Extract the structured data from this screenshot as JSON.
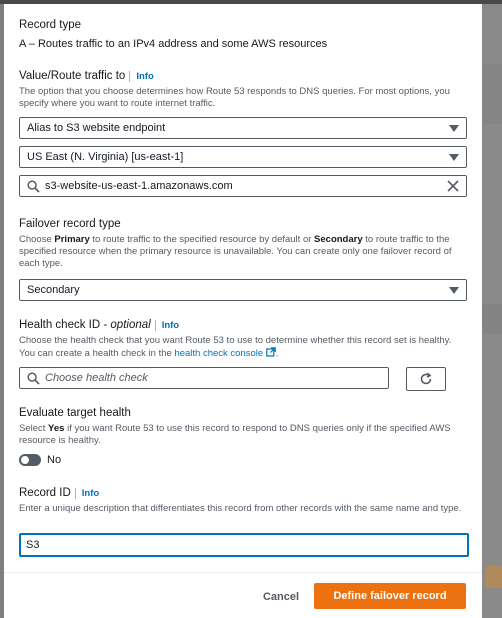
{
  "record_type": {
    "label": "Record type",
    "value": "A – Routes traffic to an IPv4 address and some AWS resources"
  },
  "value_route": {
    "label": "Value/Route traffic to",
    "info": "Info",
    "description": "The option that you choose determines how Route 53 responds to DNS queries. For most options, you specify where you want to route internet traffic.",
    "endpoint_type": "Alias to S3 website endpoint",
    "region": "US East (N. Virginia) [us-east-1]",
    "endpoint_value": "s3-website-us-east-1.amazonaws.com"
  },
  "failover": {
    "label": "Failover record type",
    "desc_1": "Choose ",
    "desc_primary": "Primary",
    "desc_2": " to route traffic to the specified resource by default or ",
    "desc_secondary": "Secondary",
    "desc_3": " to route traffic to the specified resource when the primary resource is unavailable. You can create only one failover record of each type.",
    "selected": "Secondary"
  },
  "health_check": {
    "label": "Health check ID - ",
    "optional": "optional",
    "info": "Info",
    "desc_1": "Choose the health check that you want Route 53 to use to determine whether this record set is healthy. You can create a health check in the ",
    "link": "health check console",
    "desc_2": ".",
    "placeholder": "Choose health check"
  },
  "evaluate": {
    "label": "Evaluate target health",
    "desc_1": "Select ",
    "desc_yes": "Yes",
    "desc_2": " if you want Route 53 to use this record to respond to DNS queries only if the specified AWS resource is healthy.",
    "toggle_label": "No"
  },
  "record_id": {
    "label": "Record ID",
    "info": "Info",
    "description": "Enter a unique description that differentiates this record from other records with the same name and type.",
    "value": "S3"
  },
  "footer": {
    "cancel": "Cancel",
    "submit": "Define failover record"
  },
  "colors": {
    "primary": "#ec7211",
    "link": "#0073bb"
  }
}
